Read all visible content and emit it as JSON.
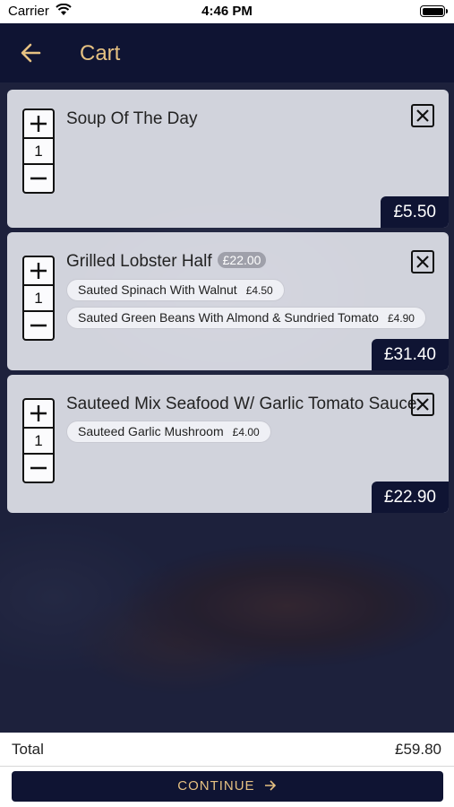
{
  "status_bar": {
    "carrier": "Carrier",
    "time": "4:46 PM"
  },
  "header": {
    "title": "Cart",
    "back_icon": "arrow-left-icon"
  },
  "colors": {
    "navy": "#0f1433",
    "gold": "#e6c182",
    "card": "#ebecf2"
  },
  "cart": {
    "items": [
      {
        "name": "Soup Of The Day",
        "qty": "1",
        "total": "£5.50",
        "options": []
      },
      {
        "name": "Grilled Lobster Half",
        "base_price": "£22.00",
        "qty": "1",
        "total": "£31.40",
        "options": [
          {
            "name": "Sauted Spinach With Walnut",
            "price": "£4.50"
          },
          {
            "name": "Sauted Green Beans With Almond & Sundried Tomato",
            "price": "£4.90"
          }
        ]
      },
      {
        "name": "Sauteed Mix Seafood W/ Garlic Tomato Sauce",
        "qty": "1",
        "total": "£22.90",
        "options": [
          {
            "name": "Sauteed Garlic Mushroom",
            "price": "£4.00"
          }
        ]
      }
    ]
  },
  "footer": {
    "total_label": "Total",
    "total_value": "£59.80",
    "continue_label": "CONTINUE"
  }
}
